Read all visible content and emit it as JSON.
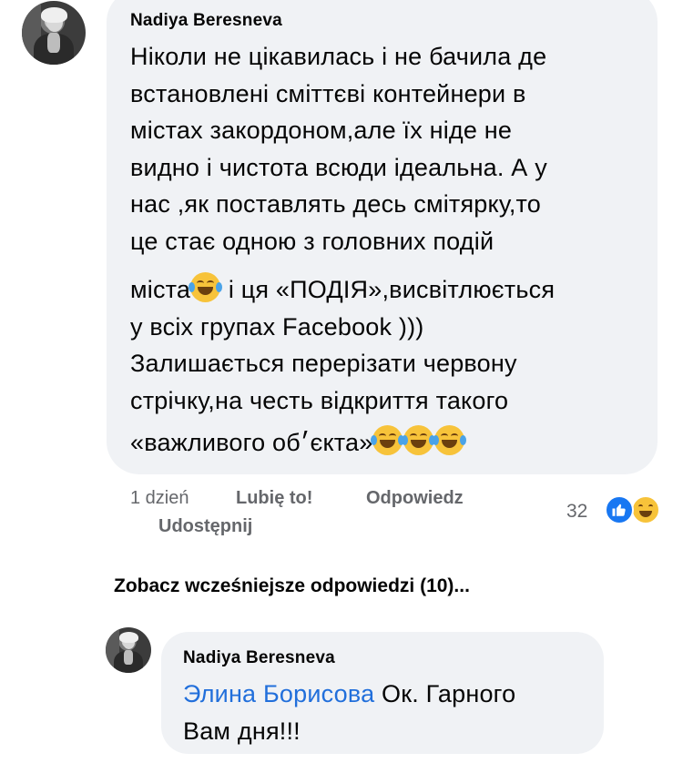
{
  "comment": {
    "author": "Nadiya Beresneva",
    "text_lines": [
      "Ніколи не цікавилась і не бачила де",
      "встановлені сміттєві контейнери в",
      "містах закордоном,але їх ніде не",
      "видно і чистота всюди ідеальна. А у",
      "нас ,як поставлять десь смітярку,то",
      "це стає одною з головних подій",
      "міста",
      " і ця «ПОДІЯ»,висвітлюється",
      "у всіх групах Facebook )))",
      "Залишається  перерізати червону",
      "стрічку,на честь відкриття такого",
      "«важливого об׳єкта»"
    ],
    "emoji": "face-with-tears-of-joy-icon"
  },
  "actions": {
    "time": "1 dzień",
    "like": "Lubię to!",
    "reply": "Odpowiedz",
    "share": "Udostępnij"
  },
  "reactions": {
    "count": "32",
    "types": [
      "like-icon",
      "haha-icon"
    ]
  },
  "see_more": "Zobacz wcześniejsze odpowiedzi (10)...",
  "reply": {
    "author": "Nadiya Beresneva",
    "mention": "Элина Борисова",
    "text_1": " Ок. Гарного",
    "text_2": "Вам дня!!!"
  },
  "colors": {
    "bubble": "#f0f2f5",
    "mention": "#216fdb",
    "meta": "#65676b",
    "like": "#1877f2"
  }
}
